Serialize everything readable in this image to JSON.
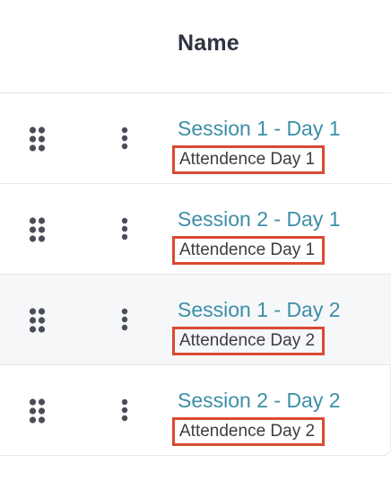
{
  "table": {
    "column_header": "Name",
    "rows": [
      {
        "title": "Session 1 - Day 1",
        "subtitle": "Attendence Day 1"
      },
      {
        "title": "Session 2 - Day 1",
        "subtitle": "Attendence Day 1"
      },
      {
        "title": "Session 1 - Day 2",
        "subtitle": "Attendence Day 2"
      },
      {
        "title": "Session 2 - Day 2",
        "subtitle": "Attendence Day 2"
      }
    ]
  },
  "icons": {
    "drag": "drag-handle-icon",
    "menu": "more-vertical-icon"
  },
  "colors": {
    "link": "#3d8fa6",
    "highlight_border": "#d94a33",
    "header_text": "#2f3340",
    "row_shade": "#f6f7f9"
  }
}
